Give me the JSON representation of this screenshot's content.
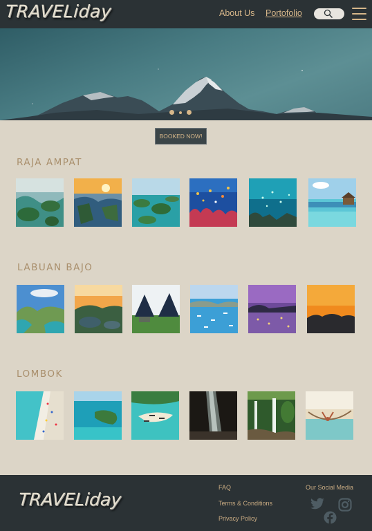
{
  "header": {
    "logo": "TRAVELiday",
    "nav": {
      "about": "About Us",
      "portofolio": "Portofolio"
    }
  },
  "hero": {
    "slides": 3,
    "active_slide": 1
  },
  "cta": {
    "book_label": "BOOKED NOW!"
  },
  "sections": [
    {
      "title": "RAJA AMPAT",
      "images": [
        "islands-aerial",
        "sunset-islands",
        "lagoon-islands",
        "coral-fish",
        "reef-fish",
        "water-villa"
      ]
    },
    {
      "title": "LABUAN BAJO",
      "images": [
        "padar-hill",
        "sunrise-bay",
        "traditional-huts",
        "harbor-boats",
        "purple-dusk-harbor",
        "orange-sunset"
      ]
    },
    {
      "title": "LOMBOK",
      "images": [
        "beach-aerial",
        "turquoise-coast",
        "sandbar-boats",
        "cave-light",
        "waterfall",
        "hammock-sea"
      ]
    }
  ],
  "footer": {
    "logo": "TRAVELiday",
    "links": {
      "faq": "FAQ",
      "terms": "Terms & Conditions",
      "privacy": "Privacy Policy"
    },
    "social_title": "Our Social Media",
    "icons": [
      "twitter-icon",
      "instagram-icon",
      "facebook-icon"
    ]
  },
  "colors": {
    "dark": "#2b3235",
    "page": "#dcd5c7",
    "accent": "#d7b78a",
    "title": "#a98f6c"
  }
}
